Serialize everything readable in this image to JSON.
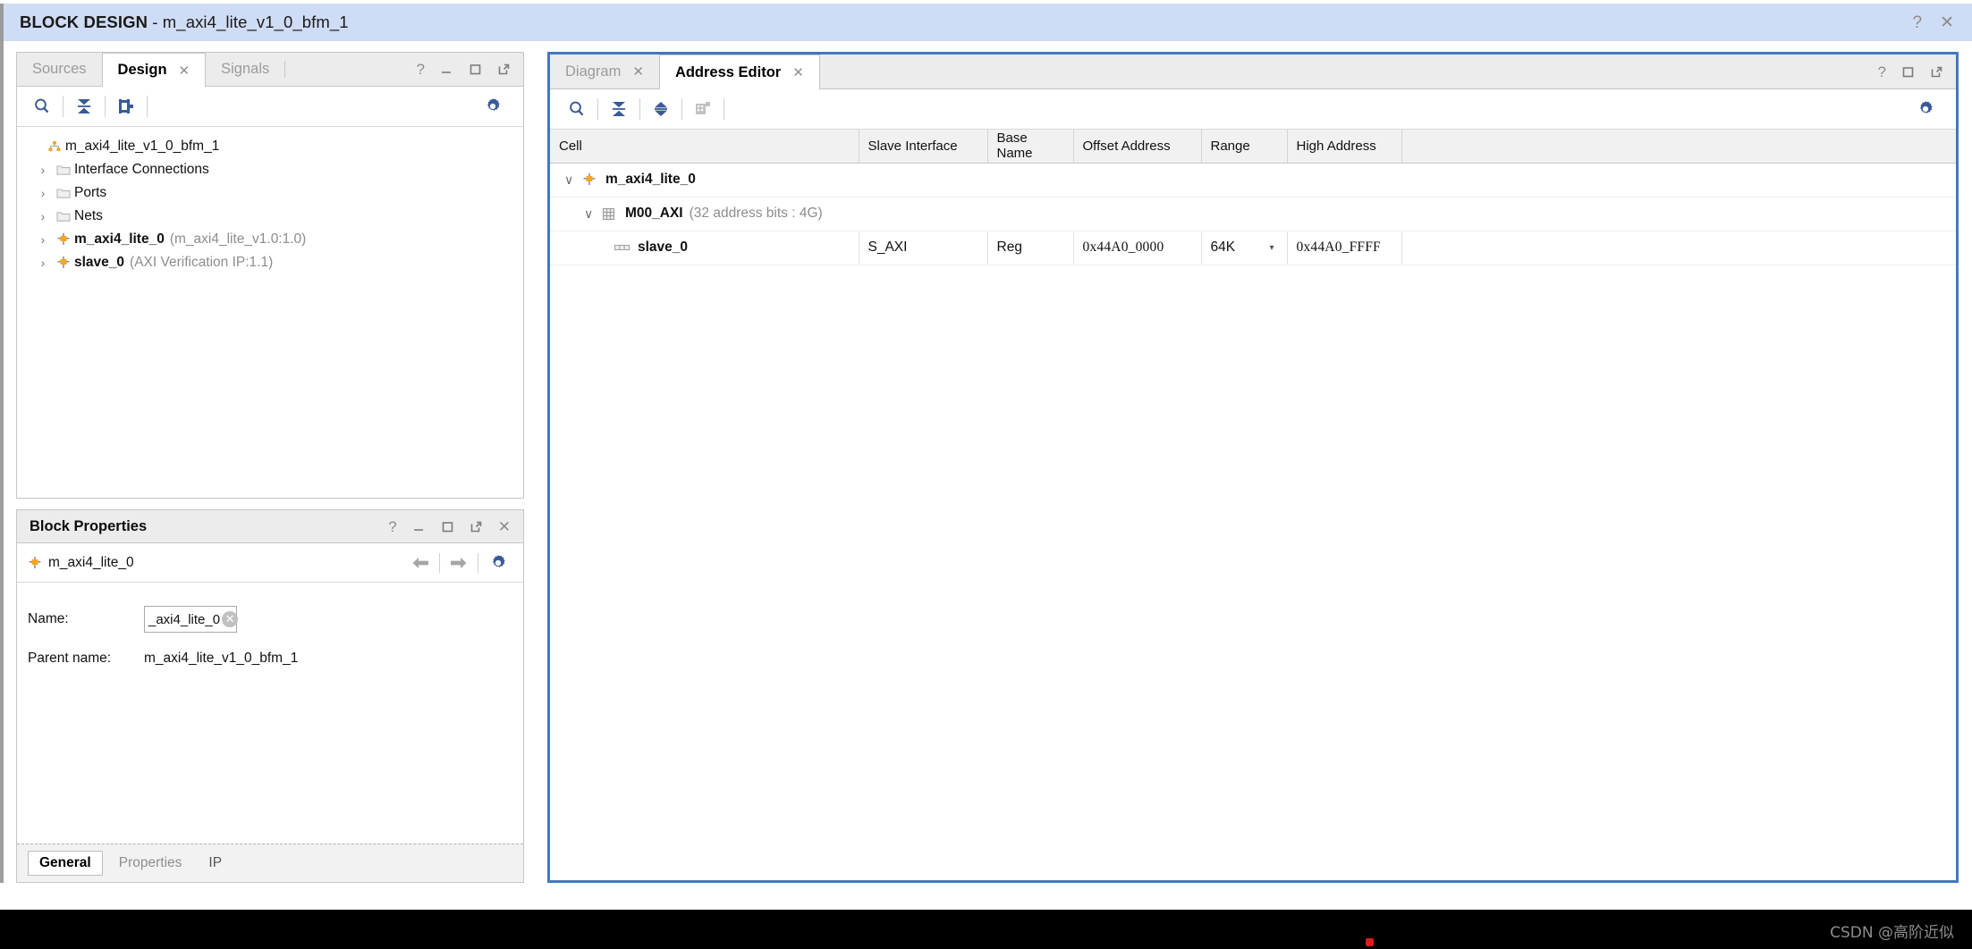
{
  "titlebar": {
    "prefix": "BLOCK DESIGN",
    "separator": " - ",
    "design_name": "m_axi4_lite_v1_0_bfm_1",
    "help_icon": "?",
    "close_icon": "✕"
  },
  "left_panel": {
    "tabs": [
      {
        "label": "Sources",
        "active": false,
        "closable": false
      },
      {
        "label": "Design",
        "active": true,
        "closable": true
      },
      {
        "label": "Signals",
        "active": false,
        "closable": false
      }
    ],
    "close_glyph": "✕",
    "header_controls": [
      "help-icon",
      "minimize-icon",
      "maximize-icon",
      "float-icon"
    ],
    "toolbar": [
      "search-icon",
      "collapse-all-icon",
      "hierarchy-icon",
      "settings-gear-icon"
    ],
    "tree": [
      {
        "label": "m_axi4_lite_v1_0_bfm_1",
        "sub": "",
        "indent": 0,
        "chevron": "",
        "icon": "block-design-icon"
      },
      {
        "label": "Interface Connections",
        "sub": "",
        "indent": 1,
        "chevron": "›",
        "icon": "folder-icon"
      },
      {
        "label": "Ports",
        "sub": "",
        "indent": 1,
        "chevron": "›",
        "icon": "folder-icon"
      },
      {
        "label": "Nets",
        "sub": "",
        "indent": 1,
        "chevron": "›",
        "icon": "folder-icon"
      },
      {
        "label": "m_axi4_lite_0",
        "sub": "(m_axi4_lite_v1.0:1.0)",
        "indent": 1,
        "chevron": "›",
        "icon": "ip-block-icon"
      },
      {
        "label": "slave_0",
        "sub": "(AXI Verification IP:1.1)",
        "indent": 1,
        "chevron": "›",
        "icon": "ip-block-icon"
      }
    ]
  },
  "block_properties": {
    "title": "Block Properties",
    "header_controls": [
      "help-icon",
      "minimize-icon",
      "maximize-icon",
      "float-icon",
      "close-icon"
    ],
    "selected_block": "m_axi4_lite_0",
    "nav": [
      "back-arrow-icon",
      "forward-arrow-icon",
      "settings-gear-icon"
    ],
    "fields": [
      {
        "label": "Name:",
        "value": "_axi4_lite_0",
        "editable": true,
        "clear_glyph": "✕"
      },
      {
        "label": "Parent name:",
        "value": "m_axi4_lite_v1_0_bfm_1",
        "editable": false
      }
    ],
    "tabs": [
      {
        "label": "General",
        "active": true
      },
      {
        "label": "Properties",
        "active": false
      },
      {
        "label": "IP",
        "active": false
      }
    ]
  },
  "right_panel": {
    "tabs": [
      {
        "label": "Diagram",
        "active": false,
        "closable": true
      },
      {
        "label": "Address Editor",
        "active": true,
        "closable": true
      }
    ],
    "close_glyph": "✕",
    "header_controls": [
      "help-icon",
      "maximize-icon",
      "float-icon"
    ],
    "toolbar": [
      "search-icon",
      "collapse-all-icon",
      "expand-all-icon",
      "auto-assign-icon",
      "settings-gear-icon"
    ],
    "focus_border_color": "#4478c0",
    "table": {
      "columns": [
        "Cell",
        "Slave Interface",
        "Base Name",
        "Offset Address",
        "Range",
        "High Address"
      ],
      "rows": [
        {
          "type": "master",
          "indent": 1,
          "chevron": "∨",
          "icon": "ip-block-icon",
          "cell": "m_axi4_lite_0",
          "cell_note": "",
          "slave_interface": "",
          "base_name": "",
          "offset_address": "",
          "range": "",
          "high_address": ""
        },
        {
          "type": "interface",
          "indent": 2,
          "chevron": "∨",
          "icon": "address-space-icon",
          "cell": "M00_AXI",
          "cell_note": "(32 address bits : 4G)",
          "slave_interface": "",
          "base_name": "",
          "offset_address": "",
          "range": "",
          "high_address": ""
        },
        {
          "type": "segment",
          "indent": 3,
          "chevron": "",
          "icon": "segment-icon",
          "cell": "slave_0",
          "cell_note": "",
          "slave_interface": "S_AXI",
          "base_name": "Reg",
          "offset_address": "0x44A0_0000",
          "range": "64K",
          "range_dropdown": "▾",
          "high_address": "0x44A0_FFFF"
        }
      ]
    }
  },
  "footer": {
    "watermark": "CSDN @高阶近似"
  },
  "colors": {
    "title_bg": "#cfdcf5",
    "focus_blue": "#4478c0",
    "icon_blue": "#3a5a96",
    "ip_orange": "#f5a623",
    "link_blue": "#2222dd",
    "panel_gray": "#ececec"
  }
}
